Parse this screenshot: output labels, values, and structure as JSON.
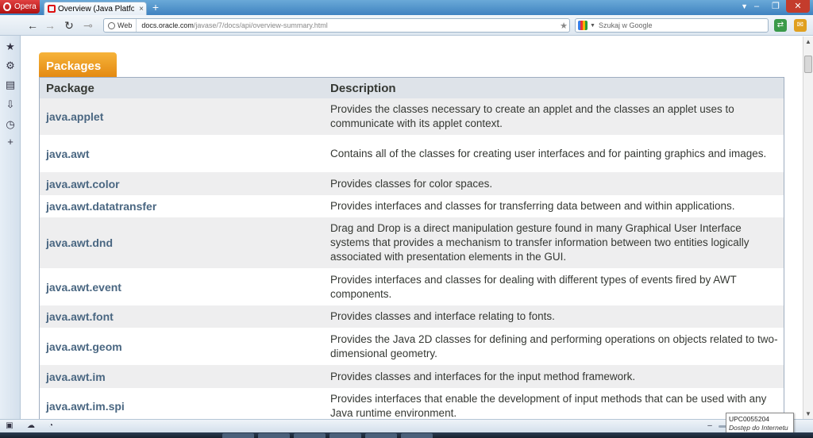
{
  "browser": {
    "menu_label": "Opera",
    "tab_title": "Overview (Java Platfor...",
    "new_tab_symbol": "+",
    "address": {
      "badge_label": "Web",
      "url_domain": "docs.oracle.com",
      "url_path": "/javase/7/docs/api/overview-summary.html"
    },
    "search_placeholder": "Szukaj w Google"
  },
  "page": {
    "packages_tab_label": "Packages",
    "table": {
      "col_package": "Package",
      "col_description": "Description",
      "rows": [
        {
          "package": "java.applet",
          "description": "Provides the classes necessary to create an applet and the classes an applet uses to communicate with its applet context."
        },
        {
          "package": "java.awt",
          "description": "Contains all of the classes for creating user interfaces and for painting graphics and images."
        },
        {
          "package": "java.awt.color",
          "description": "Provides classes for color spaces."
        },
        {
          "package": "java.awt.datatransfer",
          "description": "Provides interfaces and classes for transferring data between and within applications."
        },
        {
          "package": "java.awt.dnd",
          "description": "Drag and Drop is a direct manipulation gesture found in many Graphical User Interface systems that provides a mechanism to transfer information between two entities logically associated with presentation elements in the GUI."
        },
        {
          "package": "java.awt.event",
          "description": "Provides interfaces and classes for dealing with different types of events fired by AWT components."
        },
        {
          "package": "java.awt.font",
          "description": "Provides classes and interface relating to fonts."
        },
        {
          "package": "java.awt.geom",
          "description": "Provides the Java 2D classes for defining and performing operations on objects related to two-dimensional geometry."
        },
        {
          "package": "java.awt.im",
          "description": "Provides classes and interfaces for the input method framework."
        },
        {
          "package": "java.awt.im.spi",
          "description": "Provides interfaces that enable the development of input methods that can be used with any Java runtime environment."
        }
      ]
    }
  },
  "status": {
    "tooltip_line1": "UPC0055204",
    "tooltip_line2": "Dostęp do Internetu"
  },
  "colors": {
    "tab_orange": "#e48a12",
    "package_link": "#4a6782",
    "header_bg": "#dee3e9",
    "alt_row_bg": "#eeeeef"
  }
}
